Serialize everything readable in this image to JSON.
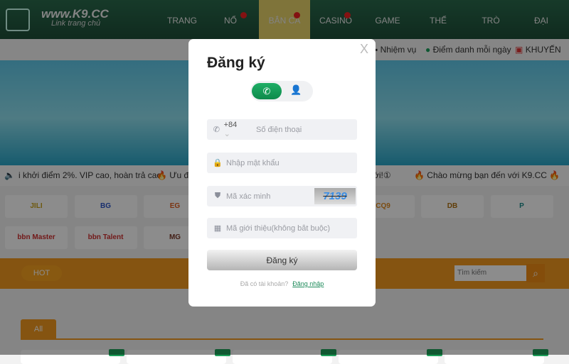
{
  "header": {
    "site": "www.K9.CC",
    "tagline": "Link trang chủ",
    "logo_text": "K9CC",
    "nav": [
      {
        "label": "TRANG CHỦ",
        "hot": false
      },
      {
        "label": "NỔ HŨ",
        "hot": true
      },
      {
        "label": "BẮN CÁ",
        "hot": true,
        "active": true
      },
      {
        "label": "CASINO",
        "hot": true
      },
      {
        "label": "GAME BÀI",
        "hot": false
      },
      {
        "label": "THỂ THAO",
        "hot": false
      },
      {
        "label": "TRÒ CHƠI",
        "hot": false
      },
      {
        "label": "ĐẠI LÝ",
        "hot": false
      }
    ]
  },
  "subbar": {
    "mission": "Nhiệm vụ",
    "checkin": "Điểm danh mỗi ngày",
    "promo": "KHUYẾN MÃI"
  },
  "ticker": {
    "t1": "i khởi điểm 2%. VIP cao, hoàn trả cao!",
    "t2": "Ưu đ",
    "t3": "mới!①",
    "t4": "Chào mừng bạn đến với K9.CC"
  },
  "providers": [
    "JILI",
    "BG",
    "EG",
    "",
    "",
    "CQ9",
    "DB",
    "P",
    "bbn Master",
    "bbn Talent",
    "MG"
  ],
  "filter": {
    "hot": "HOT",
    "search_placeholder": "Tìm kiếm"
  },
  "tabs": {
    "all": "All"
  },
  "modal": {
    "title": "Đăng ký",
    "close": "X",
    "country_code": "+84",
    "phone_placeholder": "Số điện thoại",
    "password_placeholder": "Nhập mật khẩu",
    "captcha_placeholder": "Mã xác minh",
    "captcha_code": "7139",
    "referral_placeholder": "Mã giới thiệu(không bắt buộc)",
    "submit": "Đăng ký",
    "have_account": "Đã có tài khoản?",
    "login": "Đăng nhập",
    "accent": "#1a9e5c"
  }
}
